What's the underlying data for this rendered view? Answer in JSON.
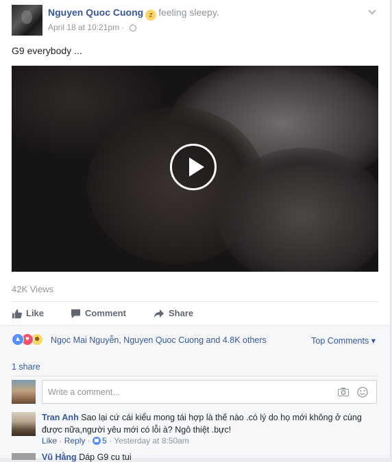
{
  "post": {
    "author": "Nguyen Quoc Cuong",
    "feeling": "feeling sleepy.",
    "feeling_icon": "sleepy-emoji-icon",
    "timestamp": "April 18 at 10:21pm",
    "separator": "·",
    "text": "G9 everybody ...",
    "views": "42K Views"
  },
  "actions": {
    "like": "Like",
    "comment": "Comment",
    "share": "Share"
  },
  "reactions": {
    "icons": [
      "like-reaction-icon",
      "love-reaction-icon",
      "haha-reaction-icon"
    ],
    "summary": "Ngọc Mai Nguyễn, Nguyen Quoc Cuong and 4.8K others",
    "top_comments": "Top Comments",
    "top_comments_caret": "▾"
  },
  "shares": "1 share",
  "comment_input": {
    "placeholder": "Write a comment..."
  },
  "comments": [
    {
      "author": "Tran Anh",
      "text": "Sao lại cứ cái kiểu mong tái hợp là thế nào .có lý do họ mới không ở cùng được nữa,người yêu mới có lỗi à? Ngô thiệt .bực!",
      "like_label": "Like",
      "reply_label": "Reply",
      "like_count": "5",
      "time": "Yesterday at 8:50am",
      "dot": "·"
    },
    {
      "author": "Vũ Hằng",
      "text": "Dáp G9 cu tui"
    }
  ],
  "colors": {
    "link": "#365899",
    "muted": "#90949c",
    "like_blue": "#5890ff",
    "love_red": "#f25268",
    "haha_yellow": "#fcd669"
  }
}
